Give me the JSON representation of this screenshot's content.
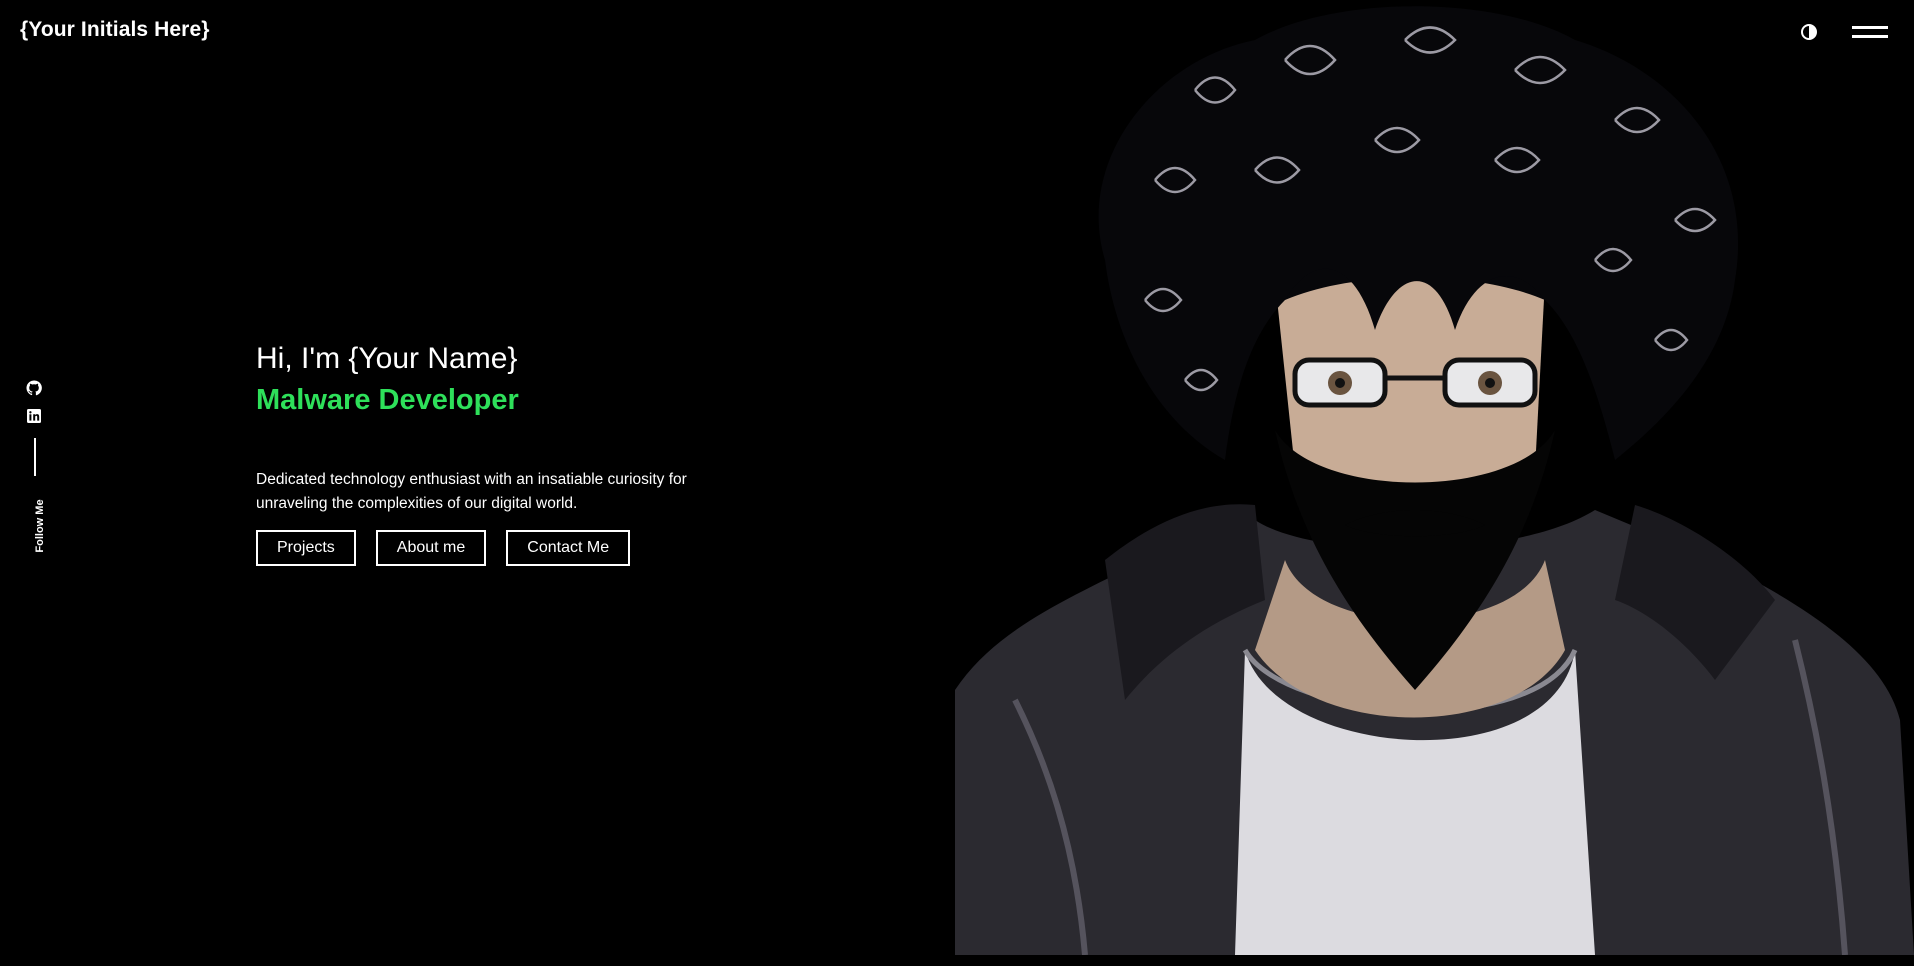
{
  "header": {
    "logo": "{Your Initials Here}",
    "theme_icon": "half-circle-contrast-icon",
    "menu_icon": "hamburger-menu-icon"
  },
  "social": {
    "items": [
      {
        "icon": "github-icon"
      },
      {
        "icon": "linkedin-icon"
      }
    ],
    "label": "Follow Me"
  },
  "hero": {
    "greeting": "Hi, I'm {Your Name}",
    "role": "Malware Developer",
    "bio": "Dedicated technology enthusiast with an insatiable curiosity for unraveling the complexities of our digital world.",
    "buttons": [
      {
        "label": "Projects"
      },
      {
        "label": "About me"
      },
      {
        "label": "Contact Me"
      }
    ]
  },
  "colors": {
    "background": "#000000",
    "text": "#ffffff",
    "accent": "#2ee05a"
  },
  "portrait": {
    "description_icon": "anime-portrait-illustration"
  }
}
